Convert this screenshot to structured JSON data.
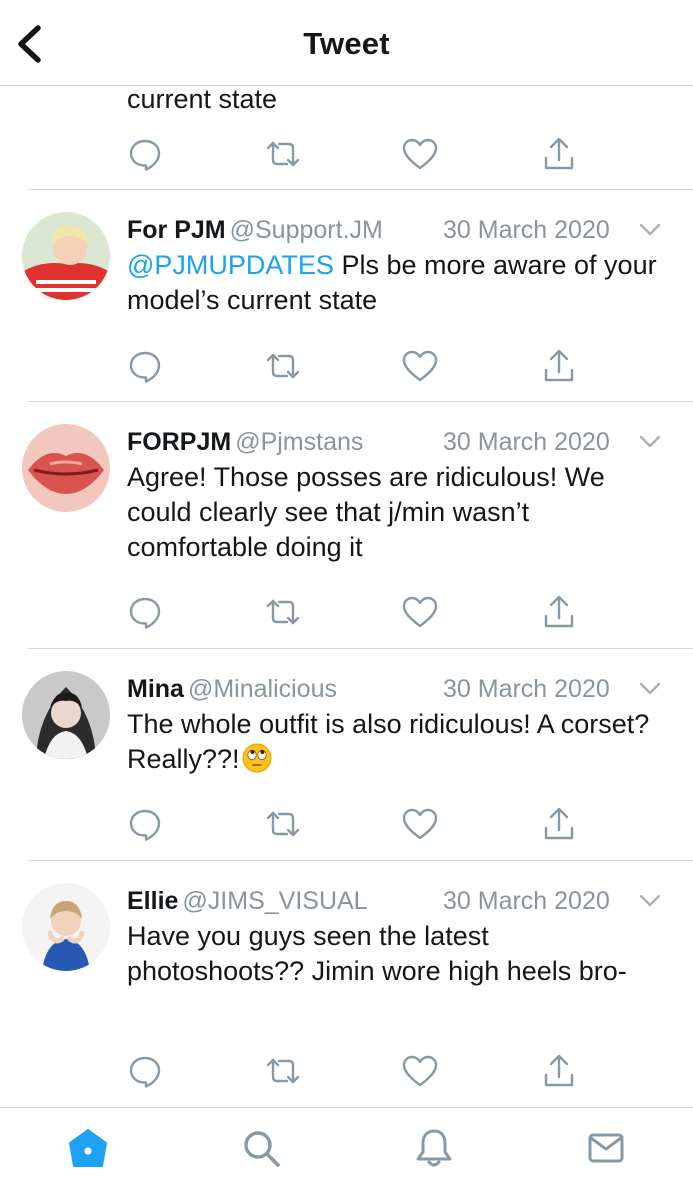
{
  "header": {
    "title": "Tweet"
  },
  "previous_tweet": {
    "text_tail": "current state"
  },
  "tweets": [
    {
      "name": "For PJM",
      "handle": "@Support.JM",
      "date": "30 March 2020",
      "mention": "@PJMUPDATES",
      "text": " Pls be more aware of your model’s current state"
    },
    {
      "name": "FORPJM",
      "handle": "@Pjmstans",
      "date": "30 March 2020",
      "text": "Agree! Those posses are ridiculous! We could clearly see that j/min wasn’t comfortable doing it"
    },
    {
      "name": "Mina",
      "handle": "@Minalicious",
      "date": "30 March 2020",
      "text": "The whole outfit is also ridiculous! A corset? Really??!"
    },
    {
      "name": "Ellie",
      "handle": "@JIMS_VISUAL",
      "date": "30 March 2020",
      "text": "Have you guys seen the latest photoshoots?? Jimin wore high heels bro-"
    }
  ],
  "colors": {
    "accent": "#1da1f2",
    "icon_gray": "#8899a6",
    "text": "#14171a",
    "secondary_text": "#8a949c",
    "divider": "#d6d9dc"
  },
  "tabbar": {
    "items": [
      "home-icon",
      "search-icon",
      "notifications-icon",
      "messages-icon"
    ],
    "active": "home-icon"
  }
}
